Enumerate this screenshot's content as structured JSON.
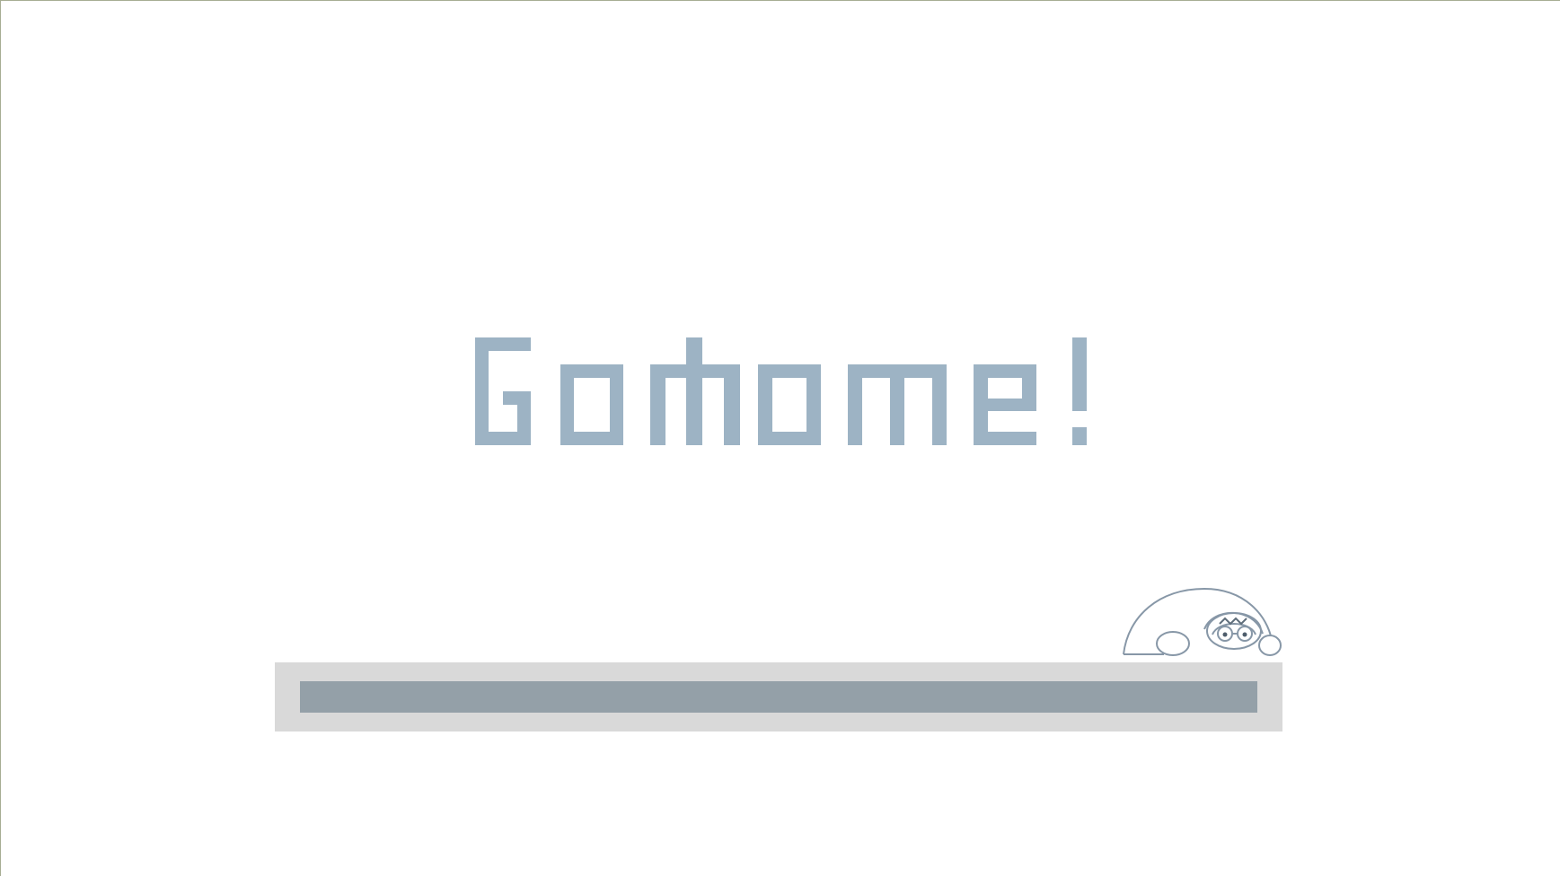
{
  "screen": {
    "title": "GoHome!",
    "title_color": "#9db3c4",
    "background_color": "#ffffff"
  },
  "loading": {
    "progress": 1.0,
    "track_color": "#d9d9d9",
    "fill_color": "#94a0a8"
  },
  "mascot": {
    "icon": "peeking-creature-icon",
    "stroke_color": "#8797a7"
  }
}
